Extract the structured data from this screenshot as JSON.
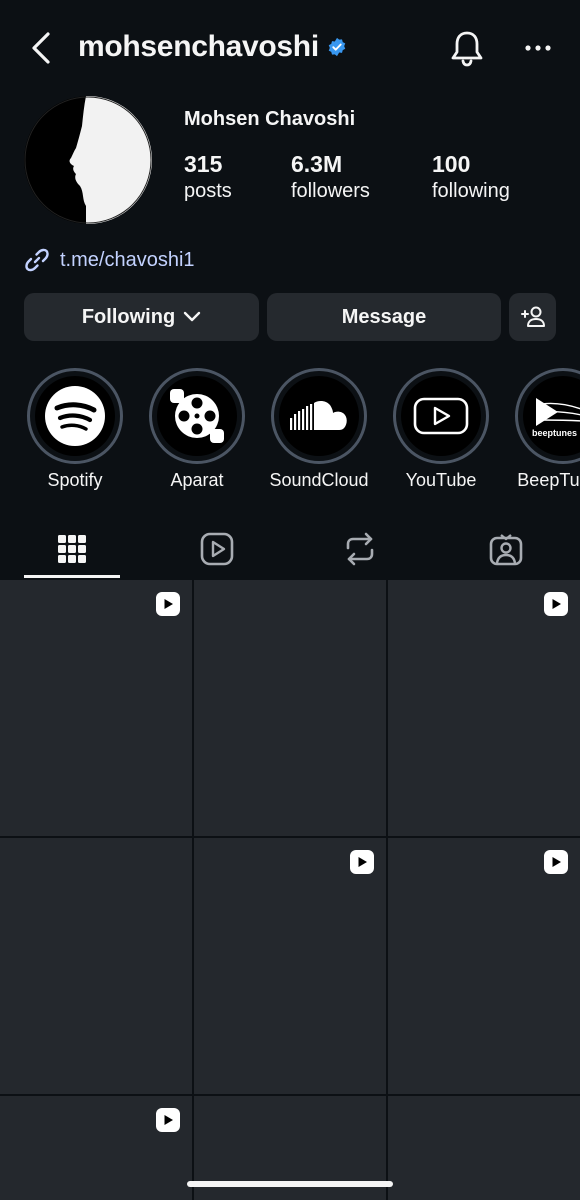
{
  "header": {
    "username": "mohsenchavoshi",
    "verified": true,
    "icons": [
      "back-arrow-icon",
      "verified-badge-icon",
      "bell-icon",
      "more-icon"
    ]
  },
  "profile": {
    "display_name": "Mohsen Chavoshi",
    "stats": [
      {
        "value": "315",
        "label": "posts"
      },
      {
        "value": "6.3M",
        "label": "followers"
      },
      {
        "value": "100",
        "label": "following"
      }
    ],
    "link": "t.me/chavoshi1"
  },
  "actions": {
    "following_label": "Following",
    "message_label": "Message"
  },
  "highlights": [
    {
      "label": "Spotify",
      "icon": "spotify-icon"
    },
    {
      "label": "Aparat",
      "icon": "aparat-icon"
    },
    {
      "label": "SoundCloud",
      "icon": "soundcloud-icon"
    },
    {
      "label": "YouTube",
      "icon": "youtube-icon"
    },
    {
      "label": "BeepTunes",
      "icon": "beeptunes-icon",
      "logo_text": "beeptunes"
    }
  ],
  "tabs": [
    {
      "name": "posts-grid",
      "icon": "grid-icon",
      "active": true
    },
    {
      "name": "reels",
      "icon": "reels-icon",
      "active": false
    },
    {
      "name": "reposts",
      "icon": "repost-icon",
      "active": false
    },
    {
      "name": "tagged",
      "icon": "tagged-icon",
      "active": false
    }
  ],
  "colors": {
    "background": "#0c1014",
    "button": "#25292e",
    "link": "#c3d2ff",
    "verified": "#3897f0",
    "tile": "#24282d"
  }
}
